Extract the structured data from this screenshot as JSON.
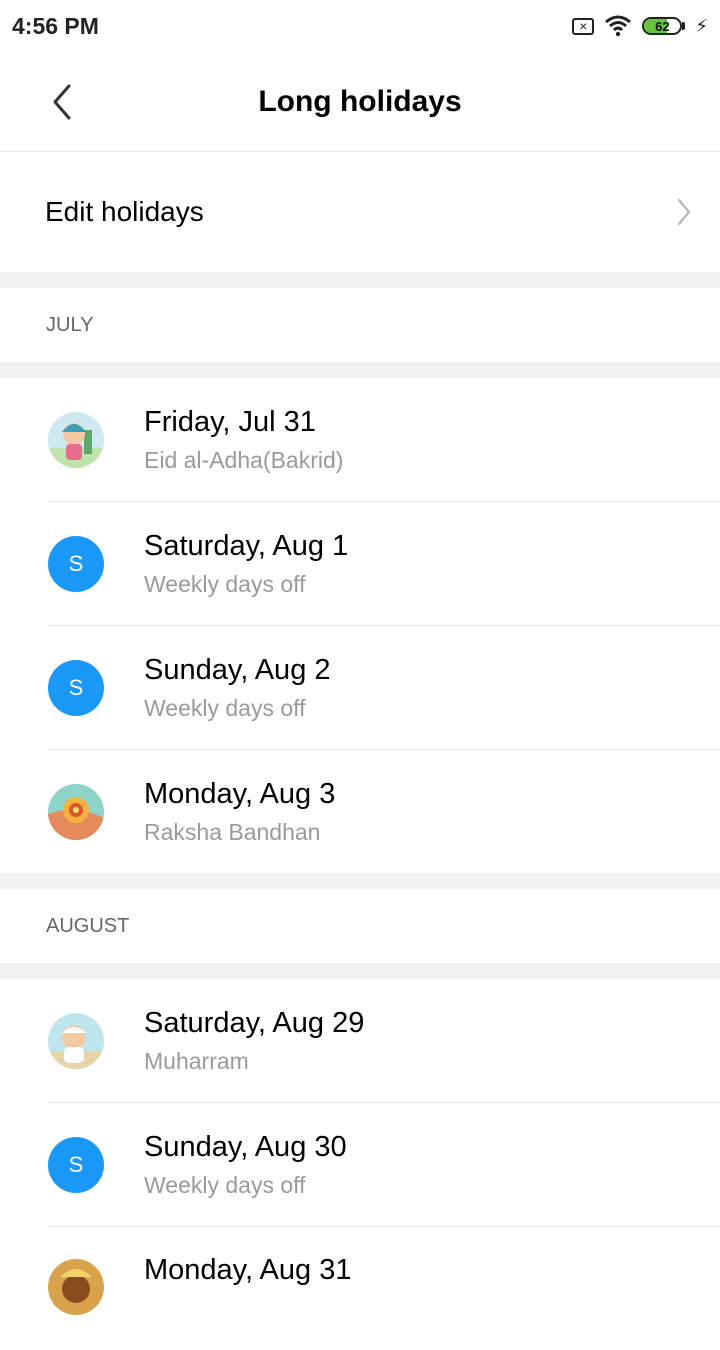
{
  "status_bar": {
    "time": "4:56 PM",
    "battery_level": "62",
    "battery_fraction": 0.62
  },
  "header": {
    "title": "Long holidays"
  },
  "edit_row": {
    "label": "Edit holidays"
  },
  "sections": [
    {
      "label": "JULY",
      "items": [
        {
          "date": "Friday, Jul 31",
          "name": "Eid al-Adha(Bakrid)",
          "avatar": "eid-illustration"
        },
        {
          "date": "Saturday, Aug 1",
          "name": "Weekly days off",
          "avatar": "S"
        },
        {
          "date": "Sunday, Aug 2",
          "name": "Weekly days off",
          "avatar": "S"
        },
        {
          "date": "Monday, Aug 3",
          "name": "Raksha Bandhan",
          "avatar": "rakhi-illustration"
        }
      ]
    },
    {
      "label": "AUGUST",
      "items": [
        {
          "date": "Saturday, Aug 29",
          "name": "Muharram",
          "avatar": "muharram-illustration"
        },
        {
          "date": "Sunday, Aug 30",
          "name": "Weekly days off",
          "avatar": "S"
        },
        {
          "date": "Monday, Aug 31",
          "name": "",
          "avatar": "onam-illustration"
        }
      ]
    }
  ],
  "colors": {
    "accent_avatar": "#1a98f8",
    "section_gap": "#f2f2f2",
    "secondary_text": "#9a9a9a"
  }
}
